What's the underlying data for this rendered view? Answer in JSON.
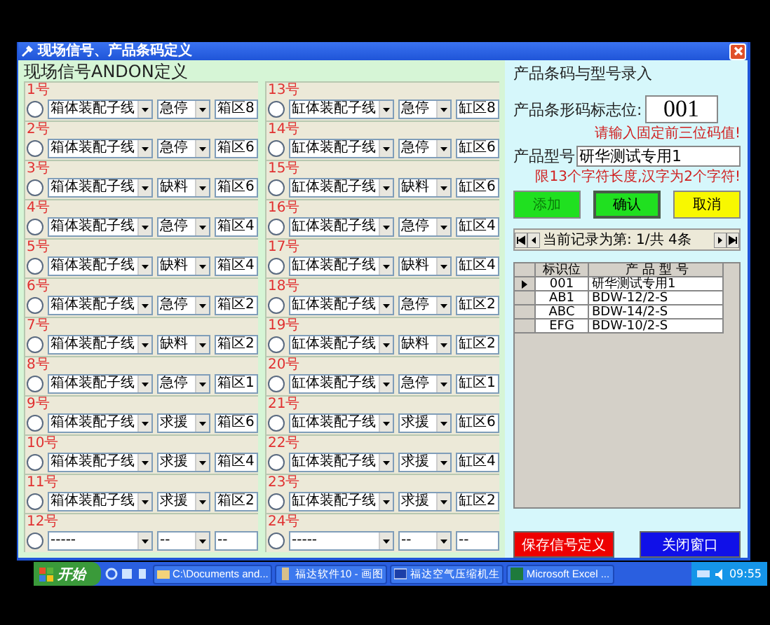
{
  "window": {
    "title": "现场信号、产品条码定义"
  },
  "andon": {
    "title": "现场信号ANDON定义",
    "columns": [
      {
        "signals": [
          {
            "label": "1号",
            "selected": false,
            "line": "箱体装配子线",
            "type": "急停",
            "area": "箱区8"
          },
          {
            "label": "2号",
            "selected": false,
            "line": "箱体装配子线",
            "type": "急停",
            "area": "箱区6"
          },
          {
            "label": "3号",
            "selected": false,
            "line": "箱体装配子线",
            "type": "缺料",
            "area": "箱区6"
          },
          {
            "label": "4号",
            "selected": false,
            "line": "箱体装配子线",
            "type": "急停",
            "area": "箱区4"
          },
          {
            "label": "5号",
            "selected": false,
            "line": "箱体装配子线",
            "type": "缺料",
            "area": "箱区4"
          },
          {
            "label": "6号",
            "selected": false,
            "line": "箱体装配子线",
            "type": "急停",
            "area": "箱区2"
          },
          {
            "label": "7号",
            "selected": false,
            "line": "箱体装配子线",
            "type": "缺料",
            "area": "箱区2"
          },
          {
            "label": "8号",
            "selected": false,
            "line": "箱体装配子线",
            "type": "急停",
            "area": "箱区1"
          },
          {
            "label": "9号",
            "selected": false,
            "line": "箱体装配子线",
            "type": "求援",
            "area": "箱区6"
          },
          {
            "label": "10号",
            "selected": false,
            "line": "箱体装配子线",
            "type": "求援",
            "area": "箱区4"
          },
          {
            "label": "11号",
            "selected": false,
            "line": "箱体装配子线",
            "type": "求援",
            "area": "箱区2"
          },
          {
            "label": "12号",
            "selected": false,
            "line": "-----",
            "type": "--",
            "area": "--"
          }
        ]
      },
      {
        "signals": [
          {
            "label": "13号",
            "selected": false,
            "line": "缸体装配子线",
            "type": "急停",
            "area": "缸区8"
          },
          {
            "label": "14号",
            "selected": false,
            "line": "缸体装配子线",
            "type": "急停",
            "area": "缸区6"
          },
          {
            "label": "15号",
            "selected": false,
            "line": "缸体装配子线",
            "type": "缺料",
            "area": "缸区6"
          },
          {
            "label": "16号",
            "selected": false,
            "line": "缸体装配子线",
            "type": "急停",
            "area": "缸区4"
          },
          {
            "label": "17号",
            "selected": false,
            "line": "缸体装配子线",
            "type": "缺料",
            "area": "缸区4"
          },
          {
            "label": "18号",
            "selected": false,
            "line": "缸体装配子线",
            "type": "急停",
            "area": "缸区2"
          },
          {
            "label": "19号",
            "selected": false,
            "line": "缸体装配子线",
            "type": "缺料",
            "area": "缸区2"
          },
          {
            "label": "20号",
            "selected": false,
            "line": "缸体装配子线",
            "type": "急停",
            "area": "缸区1"
          },
          {
            "label": "21号",
            "selected": false,
            "line": "缸体装配子线",
            "type": "求援",
            "area": "缸区6"
          },
          {
            "label": "22号",
            "selected": false,
            "line": "缸体装配子线",
            "type": "求援",
            "area": "缸区4"
          },
          {
            "label": "23号",
            "selected": false,
            "line": "缸体装配子线",
            "type": "求援",
            "area": "缸区2"
          },
          {
            "label": "24号",
            "selected": false,
            "line": "-----",
            "type": "--",
            "area": "--"
          }
        ]
      }
    ]
  },
  "product": {
    "title": "产品条码与型号录入",
    "barcode_label": "产品条形码标志位:",
    "barcode_value": "001",
    "barcode_note": "请输入固定前三位码值!",
    "model_label": "产品型号",
    "model_value": "研华测试专用1",
    "model_note": "限13个字符长度,汉字为2个字符!",
    "buttons": [
      {
        "label": "添加",
        "kind": "add",
        "disabled": true
      },
      {
        "label": "确认",
        "kind": "confirm",
        "disabled": false
      },
      {
        "label": "取消",
        "kind": "cancel",
        "disabled": false
      }
    ],
    "navigator": {
      "text": "当前记录为第: 1/共 4条"
    },
    "grid": {
      "columns": [
        "标识位",
        "产 品 型 号"
      ],
      "rows": [
        {
          "selected": true,
          "cells": [
            "001",
            "研华测试专用1"
          ]
        },
        {
          "selected": false,
          "cells": [
            "AB1",
            "BDW-12/2-S"
          ]
        },
        {
          "selected": false,
          "cells": [
            "ABC",
            "BDW-14/2-S"
          ]
        },
        {
          "selected": false,
          "cells": [
            "EFG",
            "BDW-10/2-S"
          ]
        }
      ]
    }
  },
  "actions": [
    {
      "label": "保存信号定义",
      "kind": "save"
    },
    {
      "label": "关闭窗口",
      "kind": "close"
    }
  ],
  "taskbar": {
    "start": "开始",
    "tasks": [
      {
        "label": "C:\\Documents and...",
        "kind": "folder"
      },
      {
        "label": "福达软件10 - 画图",
        "kind": "paint"
      },
      {
        "label": "福达空气压缩机生",
        "kind": "app"
      },
      {
        "label": "Microsoft Excel ...",
        "kind": "excel"
      }
    ],
    "clock": "09:55"
  }
}
